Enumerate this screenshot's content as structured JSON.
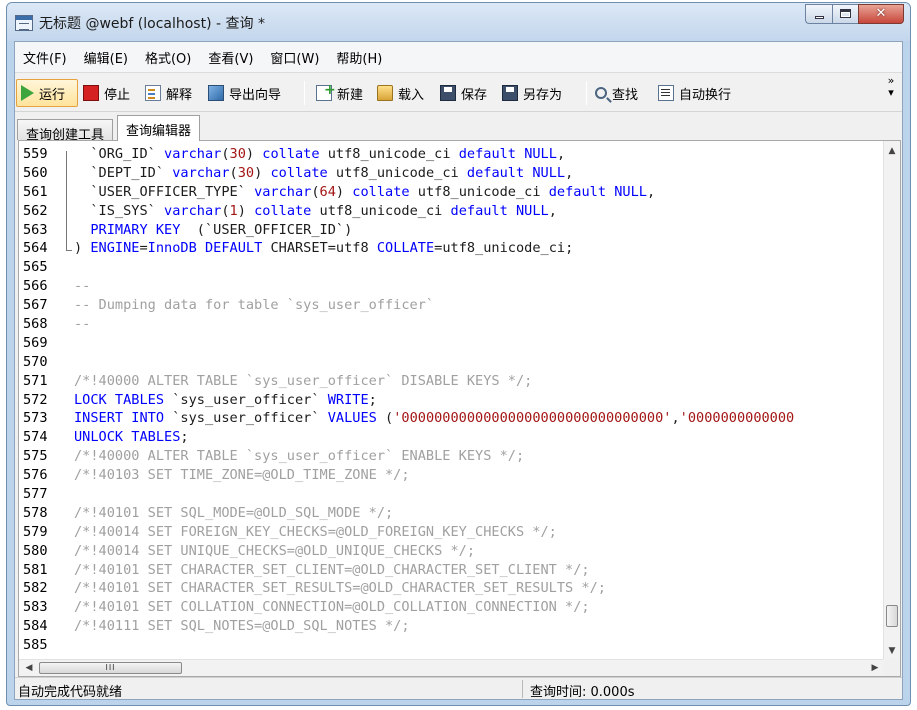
{
  "window": {
    "title": "无标题 @webf (localhost) - 查询 *"
  },
  "menu": [
    "文件(F)",
    "编辑(E)",
    "格式(O)",
    "查看(V)",
    "窗口(W)",
    "帮助(H)"
  ],
  "toolbar": {
    "run": "运行",
    "stop": "停止",
    "explain": "解释",
    "export": "导出向导",
    "new": "新建",
    "load": "载入",
    "save": "保存",
    "save_as": "另存为",
    "find": "查找",
    "word_wrap": "自动换行",
    "overflow": "»"
  },
  "tabs": [
    {
      "label": "查询创建工具",
      "active": false
    },
    {
      "label": "查询编辑器",
      "active": true
    }
  ],
  "syntax_colors": {
    "keyword": "#0000ff",
    "type": "#0000ff",
    "string": "#a31515",
    "comment": "#a0a0a0",
    "plain": "#1c1c1c"
  },
  "code_lines": [
    {
      "n": "559",
      "segs": [
        [
          "p",
          "  `ORG_ID` "
        ],
        [
          "k",
          "varchar"
        ],
        [
          "p",
          "("
        ],
        [
          "s",
          "30"
        ],
        [
          "p",
          ") "
        ],
        [
          "k",
          "collate"
        ],
        [
          "p",
          " utf8_unicode_ci "
        ],
        [
          "k",
          "default"
        ],
        [
          "p",
          " "
        ],
        [
          "k",
          "NULL"
        ],
        [
          "p",
          ","
        ]
      ]
    },
    {
      "n": "560",
      "segs": [
        [
          "p",
          "  `DEPT_ID` "
        ],
        [
          "k",
          "varchar"
        ],
        [
          "p",
          "("
        ],
        [
          "s",
          "30"
        ],
        [
          "p",
          ") "
        ],
        [
          "k",
          "collate"
        ],
        [
          "p",
          " utf8_unicode_ci "
        ],
        [
          "k",
          "default"
        ],
        [
          "p",
          " "
        ],
        [
          "k",
          "NULL"
        ],
        [
          "p",
          ","
        ]
      ]
    },
    {
      "n": "561",
      "segs": [
        [
          "p",
          "  `USER_OFFICER_TYPE` "
        ],
        [
          "k",
          "varchar"
        ],
        [
          "p",
          "("
        ],
        [
          "s",
          "64"
        ],
        [
          "p",
          ") "
        ],
        [
          "k",
          "collate"
        ],
        [
          "p",
          " utf8_unicode_ci "
        ],
        [
          "k",
          "default"
        ],
        [
          "p",
          " "
        ],
        [
          "k",
          "NULL"
        ],
        [
          "p",
          ","
        ]
      ]
    },
    {
      "n": "562",
      "segs": [
        [
          "p",
          "  `IS_SYS` "
        ],
        [
          "k",
          "varchar"
        ],
        [
          "p",
          "("
        ],
        [
          "s",
          "1"
        ],
        [
          "p",
          ") "
        ],
        [
          "k",
          "collate"
        ],
        [
          "p",
          " utf8_unicode_ci "
        ],
        [
          "k",
          "default"
        ],
        [
          "p",
          " "
        ],
        [
          "k",
          "NULL"
        ],
        [
          "p",
          ","
        ]
      ]
    },
    {
      "n": "563",
      "segs": [
        [
          "p",
          "  "
        ],
        [
          "k",
          "PRIMARY KEY"
        ],
        [
          "p",
          "  (`USER_OFFICER_ID`)"
        ]
      ]
    },
    {
      "n": "564",
      "segs": [
        [
          "p",
          ") "
        ],
        [
          "k",
          "ENGINE"
        ],
        [
          "p",
          "="
        ],
        [
          "k",
          "InnoDB"
        ],
        [
          "p",
          " "
        ],
        [
          "k",
          "DEFAULT"
        ],
        [
          "p",
          " CHARSET=utf8 "
        ],
        [
          "k",
          "COLLATE"
        ],
        [
          "p",
          "=utf8_unicode_ci;"
        ]
      ]
    },
    {
      "n": "565",
      "segs": []
    },
    {
      "n": "566",
      "segs": [
        [
          "c",
          "--"
        ]
      ]
    },
    {
      "n": "567",
      "segs": [
        [
          "c",
          "-- Dumping data for table `sys_user_officer`"
        ]
      ]
    },
    {
      "n": "568",
      "segs": [
        [
          "c",
          "--"
        ]
      ]
    },
    {
      "n": "569",
      "segs": []
    },
    {
      "n": "570",
      "segs": []
    },
    {
      "n": "571",
      "segs": [
        [
          "c",
          "/*!40000 ALTER TABLE `sys_user_officer` DISABLE KEYS */;"
        ]
      ]
    },
    {
      "n": "572",
      "segs": [
        [
          "k",
          "LOCK TABLES"
        ],
        [
          "p",
          " `sys_user_officer` "
        ],
        [
          "k",
          "WRITE"
        ],
        [
          "p",
          ";"
        ]
      ]
    },
    {
      "n": "573",
      "segs": [
        [
          "k",
          "INSERT INTO"
        ],
        [
          "p",
          " `sys_user_officer` "
        ],
        [
          "k",
          "VALUES"
        ],
        [
          "p",
          " ("
        ],
        [
          "s",
          "'00000000000000000000000000000000'"
        ],
        [
          "p",
          ","
        ],
        [
          "s",
          "'0000000000000"
        ]
      ]
    },
    {
      "n": "574",
      "segs": [
        [
          "k",
          "UNLOCK TABLES"
        ],
        [
          "p",
          ";"
        ]
      ]
    },
    {
      "n": "575",
      "segs": [
        [
          "c",
          "/*!40000 ALTER TABLE `sys_user_officer` ENABLE KEYS */;"
        ]
      ]
    },
    {
      "n": "576",
      "segs": [
        [
          "c",
          "/*!40103 SET TIME_ZONE=@OLD_TIME_ZONE */;"
        ]
      ]
    },
    {
      "n": "577",
      "segs": []
    },
    {
      "n": "578",
      "segs": [
        [
          "c",
          "/*!40101 SET SQL_MODE=@OLD_SQL_MODE */;"
        ]
      ]
    },
    {
      "n": "579",
      "segs": [
        [
          "c",
          "/*!40014 SET FOREIGN_KEY_CHECKS=@OLD_FOREIGN_KEY_CHECKS */;"
        ]
      ]
    },
    {
      "n": "580",
      "segs": [
        [
          "c",
          "/*!40014 SET UNIQUE_CHECKS=@OLD_UNIQUE_CHECKS */;"
        ]
      ]
    },
    {
      "n": "581",
      "segs": [
        [
          "c",
          "/*!40101 SET CHARACTER_SET_CLIENT=@OLD_CHARACTER_SET_CLIENT */;"
        ]
      ]
    },
    {
      "n": "582",
      "segs": [
        [
          "c",
          "/*!40101 SET CHARACTER_SET_RESULTS=@OLD_CHARACTER_SET_RESULTS */;"
        ]
      ]
    },
    {
      "n": "583",
      "segs": [
        [
          "c",
          "/*!40101 SET COLLATION_CONNECTION=@OLD_COLLATION_CONNECTION */;"
        ]
      ]
    },
    {
      "n": "584",
      "segs": [
        [
          "c",
          "/*!40111 SET SQL_NOTES=@OLD_SQL_NOTES */;"
        ]
      ]
    },
    {
      "n": "585",
      "segs": []
    }
  ],
  "scrollbar": {
    "h_thumb_grip": "III"
  },
  "status": {
    "left": "自动完成代码就绪",
    "right": "查询时间: 0.000s"
  }
}
